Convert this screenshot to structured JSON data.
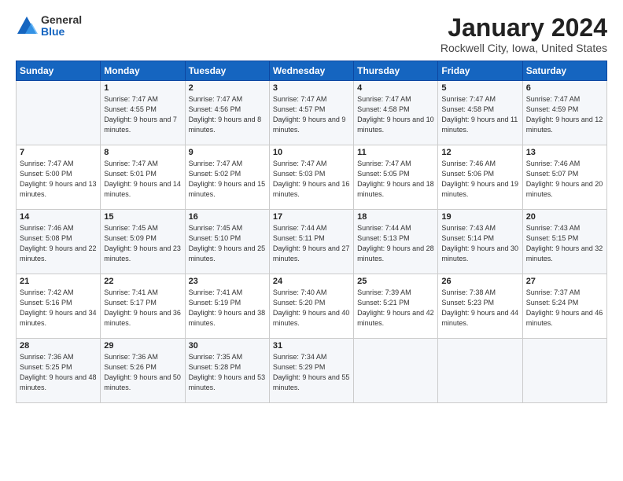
{
  "header": {
    "logo": {
      "general": "General",
      "blue": "Blue"
    },
    "title": "January 2024",
    "subtitle": "Rockwell City, Iowa, United States"
  },
  "calendar": {
    "days_of_week": [
      "Sunday",
      "Monday",
      "Tuesday",
      "Wednesday",
      "Thursday",
      "Friday",
      "Saturday"
    ],
    "weeks": [
      [
        {
          "day": "",
          "sunrise": "",
          "sunset": "",
          "daylight": ""
        },
        {
          "day": "1",
          "sunrise": "Sunrise: 7:47 AM",
          "sunset": "Sunset: 4:55 PM",
          "daylight": "Daylight: 9 hours and 7 minutes."
        },
        {
          "day": "2",
          "sunrise": "Sunrise: 7:47 AM",
          "sunset": "Sunset: 4:56 PM",
          "daylight": "Daylight: 9 hours and 8 minutes."
        },
        {
          "day": "3",
          "sunrise": "Sunrise: 7:47 AM",
          "sunset": "Sunset: 4:57 PM",
          "daylight": "Daylight: 9 hours and 9 minutes."
        },
        {
          "day": "4",
          "sunrise": "Sunrise: 7:47 AM",
          "sunset": "Sunset: 4:58 PM",
          "daylight": "Daylight: 9 hours and 10 minutes."
        },
        {
          "day": "5",
          "sunrise": "Sunrise: 7:47 AM",
          "sunset": "Sunset: 4:58 PM",
          "daylight": "Daylight: 9 hours and 11 minutes."
        },
        {
          "day": "6",
          "sunrise": "Sunrise: 7:47 AM",
          "sunset": "Sunset: 4:59 PM",
          "daylight": "Daylight: 9 hours and 12 minutes."
        }
      ],
      [
        {
          "day": "7",
          "sunrise": "Sunrise: 7:47 AM",
          "sunset": "Sunset: 5:00 PM",
          "daylight": "Daylight: 9 hours and 13 minutes."
        },
        {
          "day": "8",
          "sunrise": "Sunrise: 7:47 AM",
          "sunset": "Sunset: 5:01 PM",
          "daylight": "Daylight: 9 hours and 14 minutes."
        },
        {
          "day": "9",
          "sunrise": "Sunrise: 7:47 AM",
          "sunset": "Sunset: 5:02 PM",
          "daylight": "Daylight: 9 hours and 15 minutes."
        },
        {
          "day": "10",
          "sunrise": "Sunrise: 7:47 AM",
          "sunset": "Sunset: 5:03 PM",
          "daylight": "Daylight: 9 hours and 16 minutes."
        },
        {
          "day": "11",
          "sunrise": "Sunrise: 7:47 AM",
          "sunset": "Sunset: 5:05 PM",
          "daylight": "Daylight: 9 hours and 18 minutes."
        },
        {
          "day": "12",
          "sunrise": "Sunrise: 7:46 AM",
          "sunset": "Sunset: 5:06 PM",
          "daylight": "Daylight: 9 hours and 19 minutes."
        },
        {
          "day": "13",
          "sunrise": "Sunrise: 7:46 AM",
          "sunset": "Sunset: 5:07 PM",
          "daylight": "Daylight: 9 hours and 20 minutes."
        }
      ],
      [
        {
          "day": "14",
          "sunrise": "Sunrise: 7:46 AM",
          "sunset": "Sunset: 5:08 PM",
          "daylight": "Daylight: 9 hours and 22 minutes."
        },
        {
          "day": "15",
          "sunrise": "Sunrise: 7:45 AM",
          "sunset": "Sunset: 5:09 PM",
          "daylight": "Daylight: 9 hours and 23 minutes."
        },
        {
          "day": "16",
          "sunrise": "Sunrise: 7:45 AM",
          "sunset": "Sunset: 5:10 PM",
          "daylight": "Daylight: 9 hours and 25 minutes."
        },
        {
          "day": "17",
          "sunrise": "Sunrise: 7:44 AM",
          "sunset": "Sunset: 5:11 PM",
          "daylight": "Daylight: 9 hours and 27 minutes."
        },
        {
          "day": "18",
          "sunrise": "Sunrise: 7:44 AM",
          "sunset": "Sunset: 5:13 PM",
          "daylight": "Daylight: 9 hours and 28 minutes."
        },
        {
          "day": "19",
          "sunrise": "Sunrise: 7:43 AM",
          "sunset": "Sunset: 5:14 PM",
          "daylight": "Daylight: 9 hours and 30 minutes."
        },
        {
          "day": "20",
          "sunrise": "Sunrise: 7:43 AM",
          "sunset": "Sunset: 5:15 PM",
          "daylight": "Daylight: 9 hours and 32 minutes."
        }
      ],
      [
        {
          "day": "21",
          "sunrise": "Sunrise: 7:42 AM",
          "sunset": "Sunset: 5:16 PM",
          "daylight": "Daylight: 9 hours and 34 minutes."
        },
        {
          "day": "22",
          "sunrise": "Sunrise: 7:41 AM",
          "sunset": "Sunset: 5:17 PM",
          "daylight": "Daylight: 9 hours and 36 minutes."
        },
        {
          "day": "23",
          "sunrise": "Sunrise: 7:41 AM",
          "sunset": "Sunset: 5:19 PM",
          "daylight": "Daylight: 9 hours and 38 minutes."
        },
        {
          "day": "24",
          "sunrise": "Sunrise: 7:40 AM",
          "sunset": "Sunset: 5:20 PM",
          "daylight": "Daylight: 9 hours and 40 minutes."
        },
        {
          "day": "25",
          "sunrise": "Sunrise: 7:39 AM",
          "sunset": "Sunset: 5:21 PM",
          "daylight": "Daylight: 9 hours and 42 minutes."
        },
        {
          "day": "26",
          "sunrise": "Sunrise: 7:38 AM",
          "sunset": "Sunset: 5:23 PM",
          "daylight": "Daylight: 9 hours and 44 minutes."
        },
        {
          "day": "27",
          "sunrise": "Sunrise: 7:37 AM",
          "sunset": "Sunset: 5:24 PM",
          "daylight": "Daylight: 9 hours and 46 minutes."
        }
      ],
      [
        {
          "day": "28",
          "sunrise": "Sunrise: 7:36 AM",
          "sunset": "Sunset: 5:25 PM",
          "daylight": "Daylight: 9 hours and 48 minutes."
        },
        {
          "day": "29",
          "sunrise": "Sunrise: 7:36 AM",
          "sunset": "Sunset: 5:26 PM",
          "daylight": "Daylight: 9 hours and 50 minutes."
        },
        {
          "day": "30",
          "sunrise": "Sunrise: 7:35 AM",
          "sunset": "Sunset: 5:28 PM",
          "daylight": "Daylight: 9 hours and 53 minutes."
        },
        {
          "day": "31",
          "sunrise": "Sunrise: 7:34 AM",
          "sunset": "Sunset: 5:29 PM",
          "daylight": "Daylight: 9 hours and 55 minutes."
        },
        {
          "day": "",
          "sunrise": "",
          "sunset": "",
          "daylight": ""
        },
        {
          "day": "",
          "sunrise": "",
          "sunset": "",
          "daylight": ""
        },
        {
          "day": "",
          "sunrise": "",
          "sunset": "",
          "daylight": ""
        }
      ]
    ]
  }
}
